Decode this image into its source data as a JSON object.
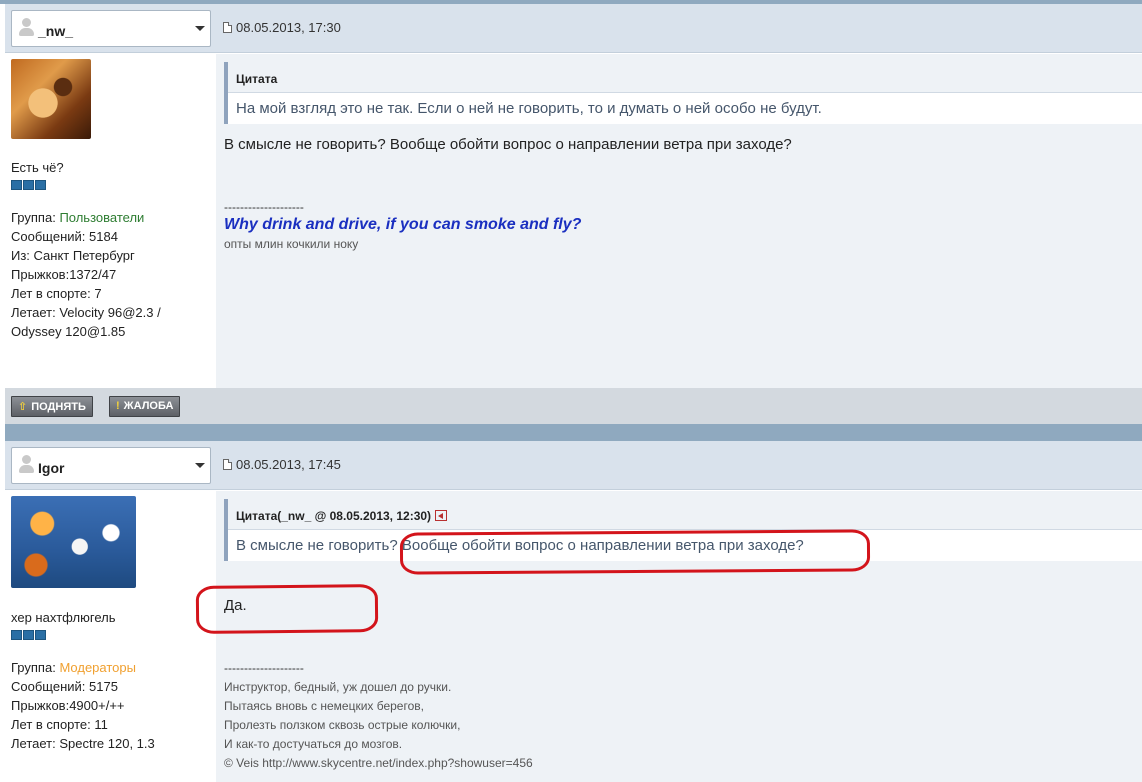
{
  "posts": [
    {
      "username": "_nw_",
      "date": "08.05.2013, 17:30",
      "usertitle": "Есть чё?",
      "stats": {
        "group_label": "Группа: ",
        "group_value": "Пользователи",
        "messages": "Сообщений: 5184",
        "from": "Из: Санкт Петербург",
        "jumps": "Прыжков:1372/47",
        "years": "Лет в спорте: 7",
        "flies1": "Летает: Velocity 96@2.3 /",
        "flies2": "Odyssey 120@1.85"
      },
      "quote": {
        "head": "Цитата",
        "body": "На мой взгляд это не так. Если о ней не говорить, то и думать о ней особо не будут."
      },
      "text": "В смысле не говорить? Вообще обойти вопрос о направлении ветра при заходе?",
      "signature": {
        "divider": "--------------------",
        "main": "Why drink and drive, if you can smoke and fly?",
        "sub": "опты млин кочкили ноку"
      }
    },
    {
      "username": "Igor",
      "date": "08.05.2013, 17:45",
      "usertitle": "хер нахтфлюгель",
      "stats": {
        "group_label": "Группа: ",
        "group_value": "Модераторы",
        "messages": "Сообщений: 5175",
        "jumps": "Прыжков:4900+/++",
        "years": "Лет в спорте: 11",
        "flies1": "Летает: Spectre 120, 1.3"
      },
      "quote": {
        "head": "Цитата(_nw_ @ 08.05.2013, 12:30)",
        "body_part1": "В смысле не говорить? ",
        "body_part2": "Вообще обойти вопрос о направлении ветра при заходе?"
      },
      "text": "Да.",
      "signature": {
        "divider": "--------------------",
        "lines": [
          "Инструктор, бедный, уж дошел до ручки.",
          "Пытаясь вновь с немецких берегов,",
          "Пролезть ползком сквозь острые колючки,",
          "И как-то достучаться до мозгов.",
          "© Veis http://www.skycentre.net/index.php?showuser=456"
        ]
      }
    }
  ],
  "buttons": {
    "up": "ПОДНЯТЬ",
    "complaint": "ЖАЛОБА"
  },
  "icons": {
    "user_menu": "user-silhouette-icon",
    "dropdown": "chevron-down-icon",
    "post_doc": "document-icon",
    "quote_back": "back-arrow-icon",
    "up": "up-arrow-icon",
    "complaint": "exclamation-icon"
  },
  "colors": {
    "header_bg": "#d9e2ec",
    "main_bg": "#eef2f6",
    "group_users": "#2e7d32",
    "group_mods": "#f0a030",
    "signature_blue": "#1a2fc0",
    "annotation_red": "#d3141b"
  }
}
